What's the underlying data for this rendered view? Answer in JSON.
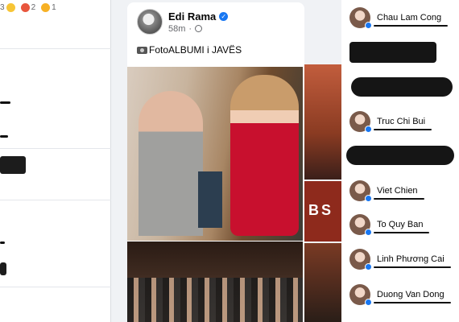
{
  "reactions": [
    {
      "icon": "haha-icon",
      "count": "3"
    },
    {
      "icon": "angry-icon",
      "count": "2"
    },
    {
      "icon": "wow-icon",
      "count": "1"
    }
  ],
  "post": {
    "author": "Edi Rama",
    "time": "58m",
    "separator": "·",
    "text": "FotoALBUMI i JAVËS",
    "overlay_text": "BS"
  },
  "friends": [
    {
      "name": "Chau Lam Cong"
    },
    {
      "name": "Truc Chi Bui"
    },
    {
      "name": "Viet Chien"
    },
    {
      "name": "To Quy Ban"
    },
    {
      "name": "Linh Phương Cai"
    },
    {
      "name": "Duong Van Dong"
    }
  ]
}
